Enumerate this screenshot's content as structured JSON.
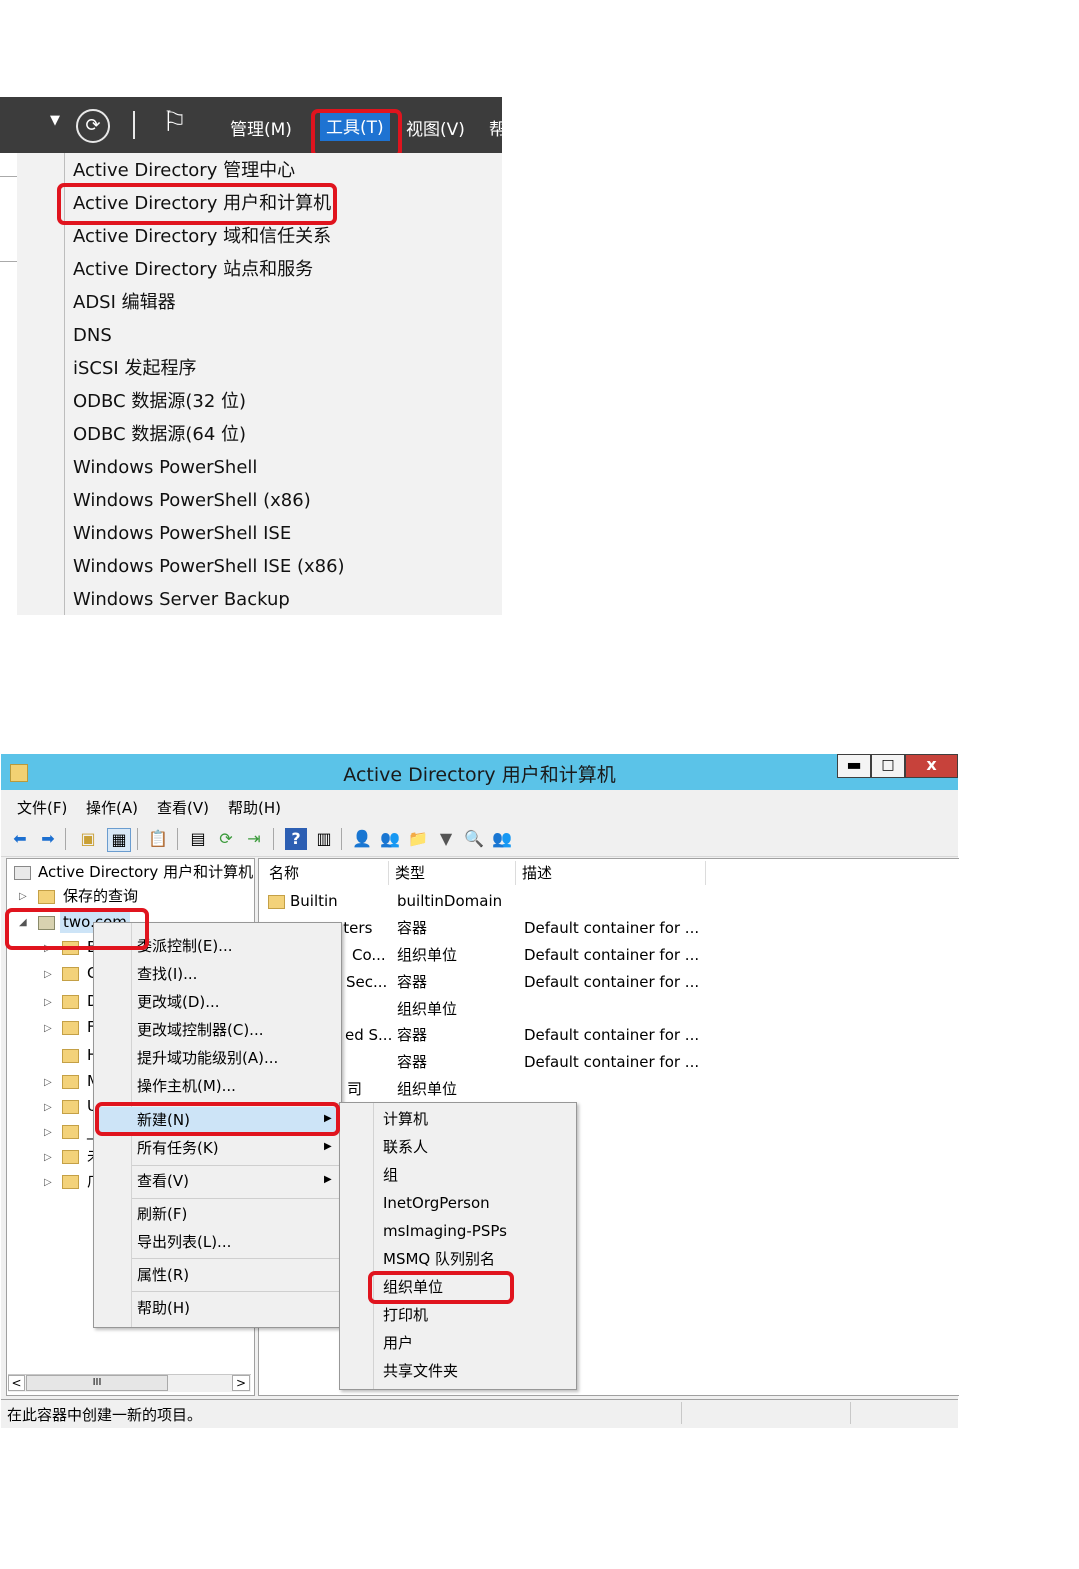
{
  "server_manager": {
    "menubar": {
      "manage": "管理(M)",
      "tools": "工具(T)",
      "view": "视图(V)",
      "help_partial": "帮"
    },
    "tools_menu": [
      "Active Directory 管理中心",
      "Active Directory 用户和计算机",
      "Active Directory 域和信任关系",
      "Active Directory 站点和服务",
      "ADSI 编辑器",
      "DNS",
      "iSCSI 发起程序",
      "ODBC 数据源(32 位)",
      "ODBC 数据源(64 位)",
      "Windows PowerShell",
      "Windows PowerShell (x86)",
      "Windows PowerShell ISE",
      "Windows PowerShell ISE (x86)",
      "Windows Server Backup"
    ]
  },
  "aduc": {
    "title": "Active Directory 用户和计算机",
    "caption_buttons": {
      "min": "▬",
      "max": "□",
      "close": "x"
    },
    "menubar": [
      "文件(F)",
      "操作(A)",
      "查看(V)",
      "帮助(H)"
    ],
    "tree": {
      "root": "Active Directory 用户和计算机",
      "saved_queries": "保存的查询",
      "domain": "two.com",
      "children_initials": [
        "B",
        "C",
        "D",
        "F",
        "H",
        "M",
        "U",
        "_",
        "未",
        "广"
      ]
    },
    "scroll": {
      "left": "<",
      "thumb": "III",
      "right": ">"
    },
    "columns": [
      "名称",
      "类型",
      "描述"
    ],
    "rows": [
      {
        "name": "Builtin",
        "type": "builtinDomain",
        "desc": ""
      },
      {
        "name": "Computers",
        "type": "容器",
        "desc": "Default container for ..."
      },
      {
        "name": "Co...",
        "type": "组织单位",
        "desc": "Default container for ..."
      },
      {
        "name": "Sec...",
        "type": "容器",
        "desc": "Default container for ..."
      },
      {
        "name": "",
        "type": "组织单位",
        "desc": ""
      },
      {
        "name": "ed S...",
        "type": "容器",
        "desc": "Default container for ..."
      },
      {
        "name": "",
        "type": "容器",
        "desc": "Default container for ..."
      },
      {
        "name": "司",
        "type": "组织单位",
        "desc": ""
      }
    ],
    "context_menu": {
      "items_top": [
        "委派控制(E)...",
        "查找(I)...",
        "更改域(D)...",
        "更改域控制器(C)...",
        "提升域功能级别(A)...",
        "操作主机(M)..."
      ],
      "new": "新建(N)",
      "all_tasks": "所有任务(K)",
      "view": "查看(V)",
      "refresh": "刷新(F)",
      "export": "导出列表(L)...",
      "properties": "属性(R)",
      "help": "帮助(H)"
    },
    "new_submenu": [
      "计算机",
      "联系人",
      "组",
      "InetOrgPerson",
      "msImaging-PSPs",
      "MSMQ 队列别名",
      "组织单位",
      "打印机",
      "用户",
      "共享文件夹"
    ],
    "status": "在此容器中创建一新的项目。"
  },
  "colors": {
    "highlight": "#e0141e",
    "titlebar": "#5bc3e8",
    "tools_active": "#1e73d2"
  }
}
